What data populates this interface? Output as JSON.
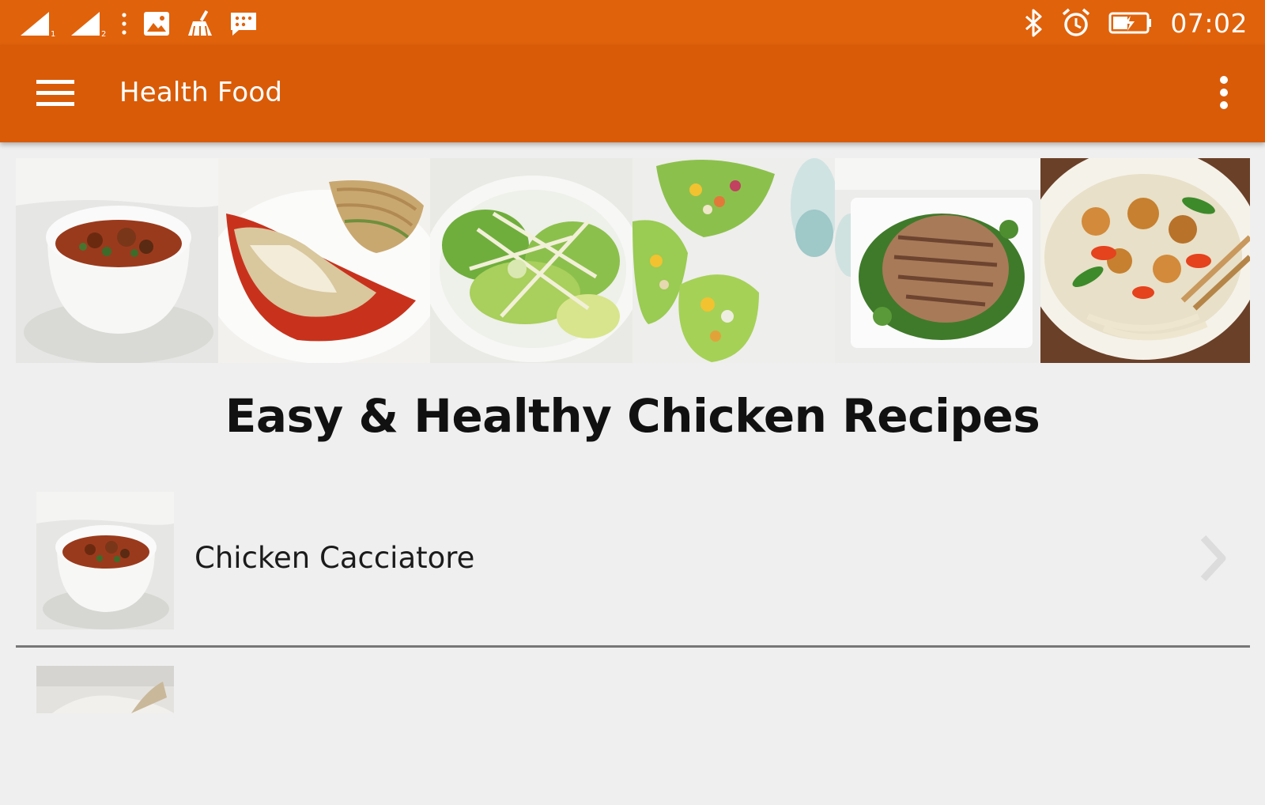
{
  "status_bar": {
    "time": "07:02",
    "left_icons": [
      "signal-sim1-icon",
      "signal-sim2-icon",
      "more-notifications-icon",
      "image-icon",
      "cleaner-icon",
      "message-icon"
    ],
    "right_icons": [
      "bluetooth-icon",
      "alarm-icon",
      "battery-charging-icon"
    ]
  },
  "toolbar": {
    "title": "Health Food",
    "menu_icon": "hamburger-menu-icon",
    "overflow_icon": "more-vert-icon"
  },
  "banner": {
    "images": [
      "chicken-soup",
      "chicken-parmesan",
      "green-salad",
      "lettuce-wraps",
      "grilled-chicken",
      "chicken-stir-fry"
    ]
  },
  "heading": "Easy & Healthy Chicken Recipes",
  "recipes": [
    {
      "name": "Chicken Cacciatore"
    },
    {
      "name": ""
    }
  ],
  "colors": {
    "status_bar": "#e0620b",
    "toolbar": "#d95b08",
    "background": "#efefef"
  }
}
